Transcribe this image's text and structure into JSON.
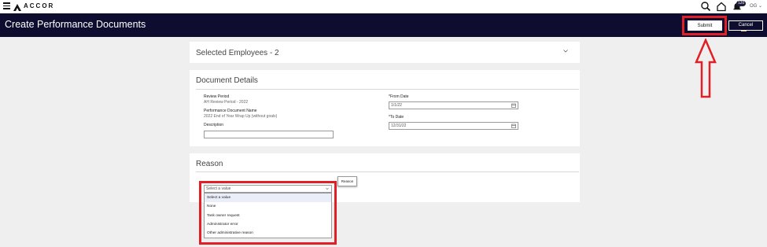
{
  "topbar": {
    "brand": "ACCOR",
    "notification_count": "120",
    "user_initials": "OG"
  },
  "header": {
    "title": "Create Performance Documents",
    "submit_label": "Submit",
    "cancel_label": "Cancel"
  },
  "selected_employees": {
    "title": "Selected Employees - 2"
  },
  "document_details": {
    "title": "Document Details",
    "review_period_label": "Review Period",
    "review_period_value": "AH Review Period - 2022",
    "doc_name_label": "Performance Document Name",
    "doc_name_value": "2022 End of Year Wrap Up (without goals)",
    "description_label": "Description",
    "description_value": "",
    "from_date_label": "*From Date",
    "from_date_value": "1/1/22",
    "to_date_label": "*To Date",
    "to_date_value": "12/31/22"
  },
  "reason": {
    "title": "Reason",
    "tooltip": "Reason",
    "select_value": "Select a value",
    "options": [
      "Select a value",
      "None",
      "Task owner request",
      "Administrator error",
      "Other administrative reason"
    ]
  },
  "colors": {
    "header_bg": "#0e0d2f",
    "highlight": "#e01f26"
  }
}
